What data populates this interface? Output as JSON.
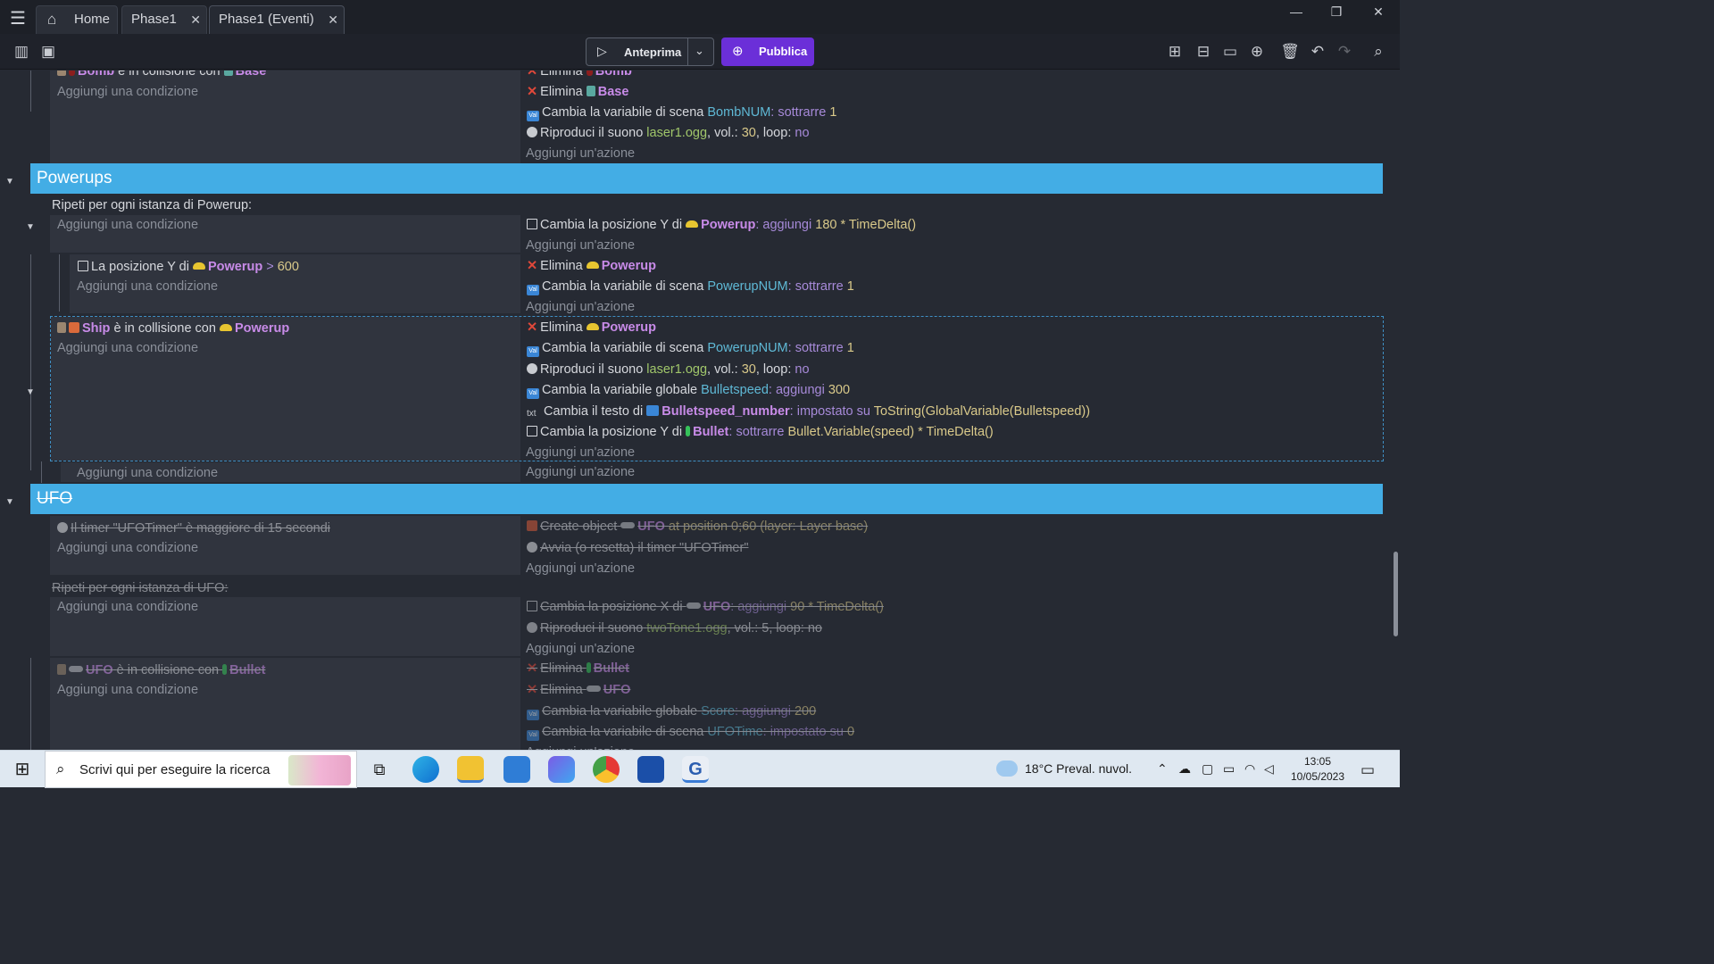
{
  "tabs": [
    {
      "label": "Home",
      "closable": false
    },
    {
      "label": "Phase1",
      "closable": true
    },
    {
      "label": "Phase1 (Eventi)",
      "closable": true,
      "active": true
    }
  ],
  "toolbar": {
    "preview_label": "Anteprima",
    "publish_label": "Pubblica"
  },
  "placeholders": {
    "add_condition": "Aggiungi una condizione",
    "add_action": "Aggiungi un'azione"
  },
  "events": {
    "bomb_event": {
      "condition": {
        "object": "Bomb",
        "text": "è in collisione con",
        "target": "Base"
      },
      "actions": [
        {
          "verb": "Elimina",
          "object": "Bomb"
        },
        {
          "verb": "Elimina",
          "object": "Base"
        },
        {
          "text": "Cambia la variabile di scena",
          "variable": "BombNUM",
          "op": "sottrarre",
          "value": "1"
        },
        {
          "text": "Riproduci il suono",
          "file": "laser1.ogg",
          "vol_label": ", vol.:",
          "vol": "30",
          "loop_label": ", loop:",
          "loop": "no"
        }
      ]
    },
    "powerups_group": "Powerups",
    "powerup_repeat": "Ripeti per ogni istanza di Powerup:",
    "powerup_move": {
      "text": "Cambia la posizione Y di",
      "object": "Powerup",
      "op": "aggiungi",
      "expr": "180 * TimeDelta()"
    },
    "powerup_sub": {
      "condition": {
        "text": "La posizione Y di",
        "object": "Powerup",
        "op": ">",
        "value": "600"
      },
      "actions": [
        {
          "verb": "Elimina",
          "object": "Powerup"
        },
        {
          "text": "Cambia la variabile di scena",
          "variable": "PowerupNUM",
          "op": "sottrarre",
          "value": "1"
        }
      ]
    },
    "ship_event": {
      "condition": {
        "object": "Ship",
        "text": "è in collisione con",
        "target": "Powerup"
      },
      "actions": [
        {
          "verb": "Elimina",
          "object": "Powerup"
        },
        {
          "text": "Cambia la variabile di scena",
          "variable": "PowerupNUM",
          "op": "sottrarre",
          "value": "1"
        },
        {
          "text": "Riproduci il suono",
          "file": "laser1.ogg",
          "vol_label": ", vol.:",
          "vol": "30",
          "loop_label": ", loop:",
          "loop": "no"
        },
        {
          "text": "Cambia la variabile globale",
          "variable": "Bulletspeed",
          "op": "aggiungi",
          "value": "300"
        },
        {
          "text": "Cambia il testo di",
          "object": "Bulletspeed_number",
          "op": "impostato su",
          "expr": "ToString(GlobalVariable(Bulletspeed))"
        },
        {
          "text": "Cambia la posizione Y di",
          "object": "Bullet",
          "op": "sottrarre",
          "expr": "Bullet.Variable(speed) * TimeDelta()"
        }
      ]
    },
    "ufo_group": "UFO",
    "ufo_timer": {
      "condition": "Il timer \"UFOTimer\" è maggiore di 15 secondi",
      "actions": [
        {
          "text": "Create object",
          "object": "UFO",
          "rest": "at position 0;60 (layer: Layer base)"
        },
        {
          "text": "Avvia (o resetta) il timer \"UFOTimer\""
        }
      ]
    },
    "ufo_repeat": "Ripeti per ogni istanza di UFO:",
    "ufo_move": [
      {
        "text": "Cambia la posizione X di",
        "object": "UFO",
        "op": ": aggiungi",
        "expr": "90 * TimeDelta()"
      },
      {
        "text": "Riproduci il suono",
        "file": "twoTone1.ogg",
        "rest": ", vol.: 5, loop: no"
      }
    ],
    "ufo_collision": {
      "condition": {
        "object": "UFO",
        "text": "è in collisione con",
        "target": "Bullet"
      },
      "actions": [
        {
          "verb": "Elimina",
          "object": "Bullet"
        },
        {
          "verb": "Elimina",
          "object": "UFO"
        },
        {
          "text": "Cambia la variabile globale",
          "variable": "Score",
          "op": ": aggiungi",
          "value": "200"
        },
        {
          "text": "Cambia la variabile di scena",
          "variable": "UFOTime",
          "op": ": impostato su",
          "value": "0"
        }
      ]
    }
  },
  "taskbar": {
    "search_placeholder": "Scrivi qui per eseguire la ricerca",
    "weather": "18°C Preval. nuvol.",
    "time": "13:05",
    "date": "10/05/2023"
  }
}
